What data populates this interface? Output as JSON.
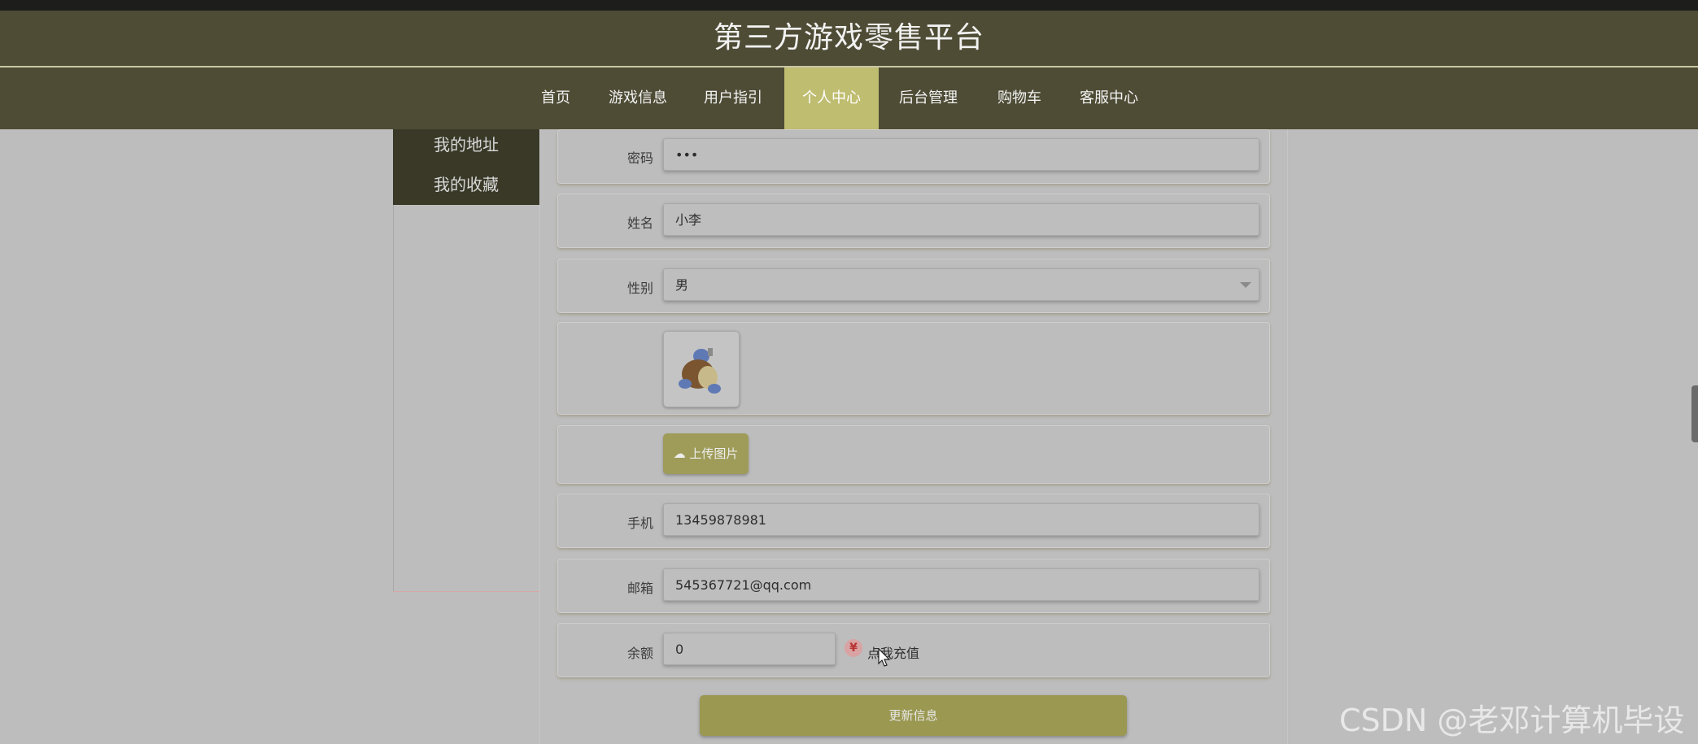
{
  "header": {
    "title": "第三方游戏零售平台"
  },
  "nav": {
    "items": [
      {
        "label": "首页"
      },
      {
        "label": "游戏信息"
      },
      {
        "label": "用户指引"
      },
      {
        "label": "个人中心"
      },
      {
        "label": "后台管理"
      },
      {
        "label": "购物车"
      },
      {
        "label": "客服中心"
      }
    ],
    "active": "个人中心"
  },
  "sidebar": {
    "items": [
      {
        "label": "我的地址"
      },
      {
        "label": "我的收藏"
      }
    ]
  },
  "form": {
    "password": {
      "label": "密码",
      "value": "•••"
    },
    "name": {
      "label": "姓名",
      "value": "小李"
    },
    "gender": {
      "label": "性别",
      "value": "男"
    },
    "upload_label": "上传图片",
    "phone": {
      "label": "手机",
      "value": "13459878981"
    },
    "email": {
      "label": "邮箱",
      "value": "545367721@qq.com"
    },
    "balance": {
      "label": "余额",
      "value": "0"
    },
    "recharge_icon": "¥",
    "recharge_label": "点我充值",
    "update_label": "更新信息"
  },
  "watermark": "CSDN @老邓计算机毕设",
  "colors": {
    "header_bg": "#4e4c35",
    "active_nav": "#bfbd70",
    "button": "#9e9c58"
  }
}
